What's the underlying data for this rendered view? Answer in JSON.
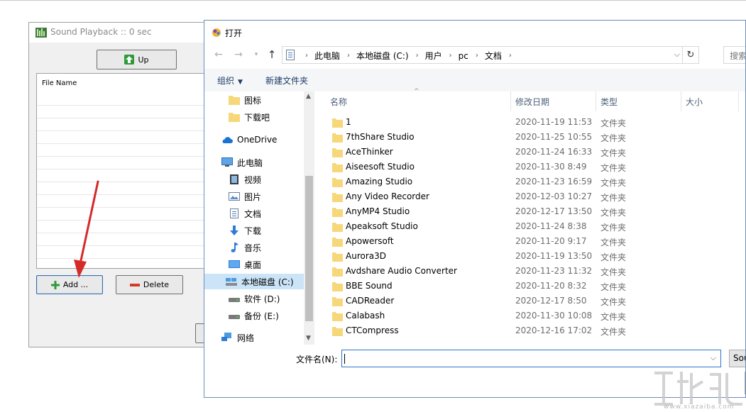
{
  "background_app": {
    "title": "Sound Playback :: 0 sec",
    "up_label": "Up",
    "list_header": "File Name",
    "add_label": "Add ...",
    "delete_label": "Delete"
  },
  "dialog": {
    "title": "打开",
    "breadcrumbs": [
      "此电脑",
      "本地磁盘 (C:)",
      "用户",
      "pc",
      "文档"
    ],
    "search_placeholder": "搜索",
    "toolbar": {
      "organize": "组织",
      "new_folder": "新建文件夹"
    },
    "nav_items": [
      {
        "label": "图标",
        "icon": "folder-icon"
      },
      {
        "label": "下载吧",
        "icon": "folder-icon"
      },
      {
        "label": "OneDrive",
        "icon": "cloud-icon"
      },
      {
        "label": "此电脑",
        "icon": "computer-icon"
      },
      {
        "label": "视频",
        "icon": "video-icon"
      },
      {
        "label": "图片",
        "icon": "pictures-icon"
      },
      {
        "label": "文档",
        "icon": "document-icon"
      },
      {
        "label": "下载",
        "icon": "download-icon"
      },
      {
        "label": "音乐",
        "icon": "music-icon"
      },
      {
        "label": "桌面",
        "icon": "desktop-icon"
      },
      {
        "label": "本地磁盘 (C:)",
        "icon": "drive-c-icon",
        "selected": true
      },
      {
        "label": "软件 (D:)",
        "icon": "drive-icon"
      },
      {
        "label": "备份 (E:)",
        "icon": "drive-icon"
      },
      {
        "label": "网络",
        "icon": "network-icon"
      }
    ],
    "columns": [
      "名称",
      "修改日期",
      "类型",
      "大小"
    ],
    "files": [
      {
        "name": "1",
        "date": "2020-11-19 11:53",
        "type": "文件夹"
      },
      {
        "name": "7thShare Studio",
        "date": "2020-11-25 10:55",
        "type": "文件夹"
      },
      {
        "name": "AceThinker",
        "date": "2020-11-24 16:33",
        "type": "文件夹"
      },
      {
        "name": "Aiseesoft Studio",
        "date": "2020-11-30 8:49",
        "type": "文件夹"
      },
      {
        "name": "Amazing Studio",
        "date": "2020-11-23 16:59",
        "type": "文件夹"
      },
      {
        "name": "Any Video Recorder",
        "date": "2020-12-03 10:27",
        "type": "文件夹"
      },
      {
        "name": "AnyMP4 Studio",
        "date": "2020-12-17 13:50",
        "type": "文件夹"
      },
      {
        "name": "Apeaksoft Studio",
        "date": "2020-11-24 8:38",
        "type": "文件夹"
      },
      {
        "name": "Apowersoft",
        "date": "2020-11-20 9:17",
        "type": "文件夹"
      },
      {
        "name": "Aurora3D",
        "date": "2020-11-19 13:50",
        "type": "文件夹"
      },
      {
        "name": "Avdshare Audio Converter",
        "date": "2020-11-23 11:32",
        "type": "文件夹"
      },
      {
        "name": "BBE Sound",
        "date": "2020-11-20 8:32",
        "type": "文件夹"
      },
      {
        "name": "CADReader",
        "date": "2020-12-17 8:50",
        "type": "文件夹"
      },
      {
        "name": "Calabash",
        "date": "2020-11-30 10:08",
        "type": "文件夹"
      },
      {
        "name": "CTCompress",
        "date": "2020-12-16 17:02",
        "type": "文件夹"
      }
    ],
    "filename_label": "文件名(N):",
    "filename_value": "",
    "filter_label": "Sou"
  },
  "watermark": {
    "url": "www.xiazaiba.com"
  },
  "colors": {
    "arrow": "#d42a2a",
    "folder": "#f6d77a",
    "selection": "#cce4f7",
    "link": "#1b3d6b"
  }
}
